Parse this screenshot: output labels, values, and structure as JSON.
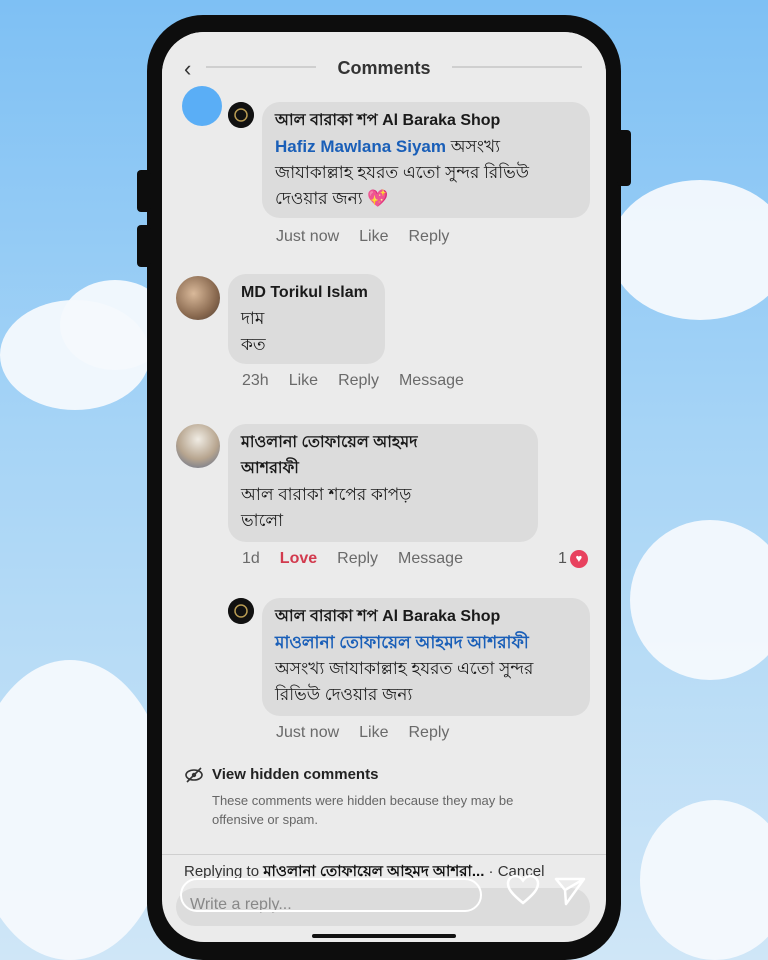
{
  "header": {
    "back_icon": "chevron-left-icon",
    "title": "Comments"
  },
  "comments": [
    {
      "author": "আল বারাকা শপ Al Baraka Shop",
      "mention": "Hafiz Mawlana Siyam",
      "text_line1": "অসংখ্য",
      "text_line2": "জাযাকাল্লাহ হযরত এতো সুন্দর রিভিউ",
      "text_line3": "দেওয়ার জন্য 💖",
      "time": "Just now",
      "like": "Like",
      "reply": "Reply"
    },
    {
      "author": "MD Torikul Islam",
      "text_line1": "দাম",
      "text_line2": "কত",
      "time": "23h",
      "like": "Like",
      "reply": "Reply",
      "message": "Message"
    },
    {
      "author_line1": "মাওলানা তোফায়েল আহমদ",
      "author_line2": "আশরাফী",
      "text_line1": "আল বারাকা শপের কাপড়",
      "text_line2": "ভালো",
      "time": "1d",
      "reaction": "Love",
      "reply": "Reply",
      "message": "Message",
      "reaction_count": "1"
    },
    {
      "author": "আল বারাকা শপ Al Baraka Shop",
      "mention": "মাওলানা তোফায়েল আহমদ আশরাফী",
      "text_line1": "অসংখ্য জাযাকাল্লাহ হযরত এতো সুন্দর",
      "text_line2": "রিভিউ দেওয়ার জন্য",
      "time": "Just now",
      "like": "Like",
      "reply": "Reply"
    }
  ],
  "hidden_comments": {
    "title": "View hidden comments",
    "description_line1": "These comments were hidden because they may be",
    "description_line2": "offensive or spam."
  },
  "reply_bar": {
    "prefix": "Replying to",
    "name": "মাওলানা তোফায়েল আহমদ আশরা...",
    "cancel": "· Cancel"
  },
  "composer": {
    "placeholder": "Write a reply..."
  },
  "colors": {
    "accent": "#1a5fb8",
    "love": "#d23a4e",
    "sky": "#7ec0f4"
  }
}
